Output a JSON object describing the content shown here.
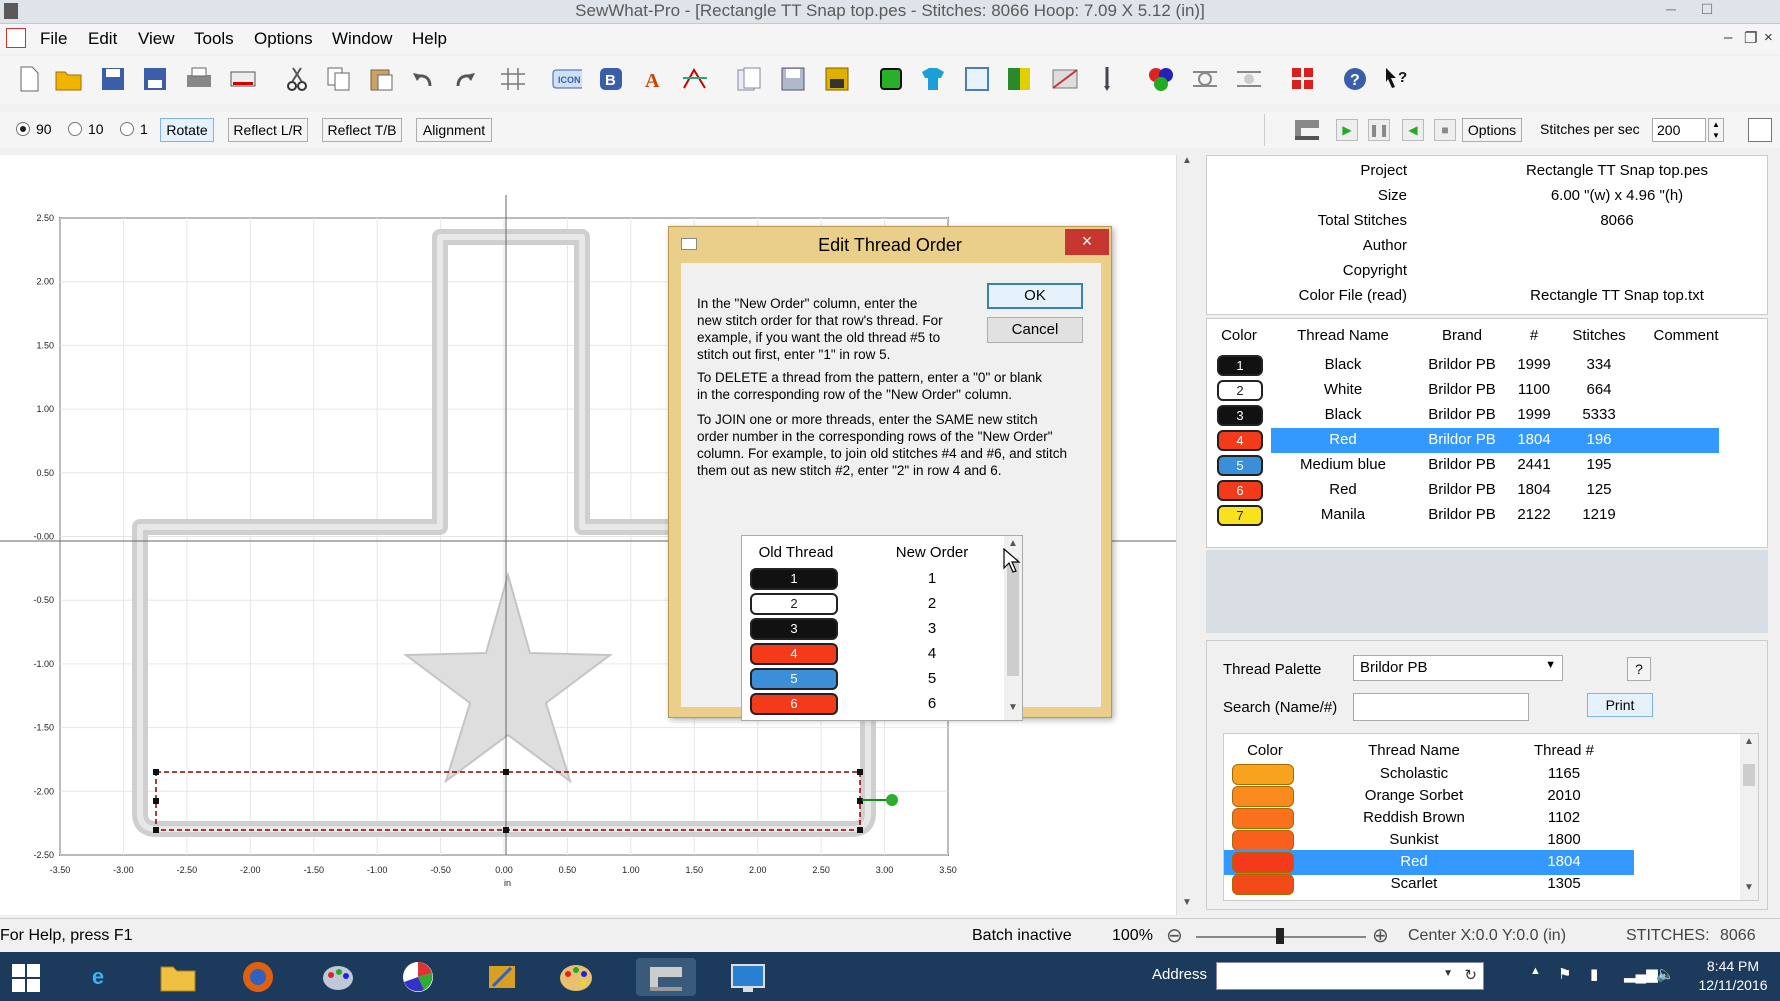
{
  "window": {
    "title": "SewWhat-Pro - [Rectangle TT Snap top.pes - Stitches: 8066 Hoop: 7.09 X 5.12 (in)]",
    "min": "─",
    "max": "☐",
    "mdi_min": "‒",
    "mdi_restore": "❐",
    "mdi_close": "×"
  },
  "menu": [
    "File",
    "Edit",
    "View",
    "Tools",
    "Options",
    "Window",
    "Help"
  ],
  "toolbar2": {
    "radio_90": "90",
    "radio_10": "10",
    "radio_1": "1",
    "rotate": "Rotate",
    "reflect_lr": "Reflect L/R",
    "reflect_tb": "Reflect T/B",
    "alignment": "Alignment",
    "options": "Options",
    "stitches_per_sec_label": "Stitches per sec",
    "stitches_per_sec_value": "200"
  },
  "axes": {
    "y_ticks": [
      "2.50",
      "2.00",
      "1.50",
      "1.00",
      "0.50",
      "-0.00",
      "-0.50",
      "-1.00",
      "-1.50",
      "-2.00",
      "-2.50"
    ],
    "x_ticks": [
      "-3.50",
      "-3.00",
      "-2.50",
      "-2.00",
      "-1.50",
      "-1.00",
      "-0.50",
      "0.00",
      "0.50",
      "1.00",
      "1.50",
      "2.00",
      "2.50",
      "3.00",
      "3.50"
    ],
    "x_unit": "in"
  },
  "project_info": [
    {
      "key": "Project",
      "value": "Rectangle TT Snap top.pes"
    },
    {
      "key": "Size",
      "value": "6.00 \"(w) x 4.96 \"(h)"
    },
    {
      "key": "Total Stitches",
      "value": "8066"
    },
    {
      "key": "Author",
      "value": ""
    },
    {
      "key": "Copyright",
      "value": ""
    },
    {
      "key": "Color File (read)",
      "value": "Rectangle TT Snap top.txt"
    }
  ],
  "thread_table": {
    "headers": [
      "Color",
      "Thread Name",
      "Brand",
      "#",
      "Stitches",
      "Comment"
    ],
    "rows": [
      {
        "idx": "1",
        "color": "#111111",
        "name": "Black",
        "brand": "Brildor PB",
        "num": "1999",
        "stitches": "334",
        "comment": ""
      },
      {
        "idx": "2",
        "color": "#ffffff",
        "name": "White",
        "brand": "Brildor PB",
        "num": "1100",
        "stitches": "664",
        "comment": ""
      },
      {
        "idx": "3",
        "color": "#111111",
        "name": "Black",
        "brand": "Brildor PB",
        "num": "1999",
        "stitches": "5333",
        "comment": ""
      },
      {
        "idx": "4",
        "color": "#f33a1a",
        "name": "Red",
        "brand": "Brildor PB",
        "num": "1804",
        "stitches": "196",
        "comment": "",
        "selected": true
      },
      {
        "idx": "5",
        "color": "#3b8fd8",
        "name": "Medium blue",
        "brand": "Brildor PB",
        "num": "2441",
        "stitches": "195",
        "comment": ""
      },
      {
        "idx": "6",
        "color": "#f33a1a",
        "name": "Red",
        "brand": "Brildor PB",
        "num": "1804",
        "stitches": "125",
        "comment": ""
      },
      {
        "idx": "7",
        "color": "#f7e21b",
        "name": "Manila",
        "brand": "Brildor PB",
        "num": "2122",
        "stitches": "1219",
        "comment": ""
      }
    ]
  },
  "palette": {
    "label": "Thread Palette",
    "selected": "Brildor PB",
    "help": "?",
    "search_label": "Search (Name/#)",
    "search_value": "",
    "print": "Print",
    "headers": [
      "Color",
      "Thread Name",
      "Thread #"
    ],
    "rows": [
      {
        "color": "#f9a21d",
        "name": "Scholastic",
        "num": "1165"
      },
      {
        "color": "#f98a1d",
        "name": "Orange Sorbet",
        "num": "2010"
      },
      {
        "color": "#f9701d",
        "name": "Reddish Brown",
        "num": "1102"
      },
      {
        "color": "#f9601d",
        "name": "Sunkist",
        "num": "1800"
      },
      {
        "color": "#f33a1a",
        "name": "Red",
        "num": "1804",
        "selected": true
      },
      {
        "color": "#f34a1a",
        "name": "Scarlet",
        "num": "1305"
      }
    ]
  },
  "dialog": {
    "title": "Edit Thread Order",
    "close": "×",
    "ok": "OK",
    "cancel": "Cancel",
    "p1": [
      "In the \"New Order\" column, enter the",
      "new stitch order for that row's thread. For",
      "example, if you want the old thread #5 to",
      "stitch out first, enter \"1\" in row 5."
    ],
    "p2": [
      "To DELETE a thread from the pattern, enter a \"0\" or blank",
      "in the corresponding row of the \"New Order\" column."
    ],
    "p3": [
      "To JOIN one or more threads, enter the SAME new stitch",
      "order number in the corresponding rows of the \"New Order\"",
      "column. For example, to join old stitches #4 and #6, and stitch",
      "them out as new stitch #2, enter \"2\" in row 4 and 6."
    ],
    "col_old": "Old Thread",
    "col_new": "New Order",
    "rows": [
      {
        "idx": "1",
        "color": "#111111",
        "new": "1"
      },
      {
        "idx": "2",
        "color": "#ffffff",
        "new": "2"
      },
      {
        "idx": "3",
        "color": "#111111",
        "new": "3"
      },
      {
        "idx": "4",
        "color": "#f33a1a",
        "new": "4"
      },
      {
        "idx": "5",
        "color": "#3b8fd8",
        "new": "5"
      },
      {
        "idx": "6",
        "color": "#f33a1a",
        "new": "6"
      }
    ]
  },
  "status": {
    "help": "For Help, press F1",
    "batch": "Batch inactive",
    "zoom": "100%",
    "minus": "⊖",
    "plus": "⊕",
    "center": "Center X:0.0  Y:0.0 (in)",
    "stitches_label": "STITCHES:",
    "stitches_value": "8066"
  },
  "taskbar": {
    "address_label": "Address",
    "time": "8:44 PM",
    "date": "12/11/2016"
  },
  "colors": {
    "selection": "#3399ff",
    "dialog_frame": "#e9cf8a",
    "taskbar": "#1b3a5c"
  }
}
